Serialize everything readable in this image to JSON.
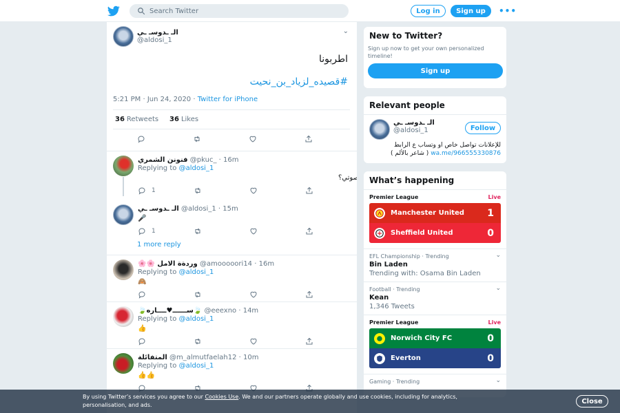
{
  "header": {
    "search_placeholder": "Search Twitter",
    "login_label": "Log in",
    "signup_label": "Sign up",
    "more_label": "•••"
  },
  "tweet": {
    "author_name": "الـ ـدوسـ ـي",
    "author_handle": "@aldosi_1",
    "text": "اطربونا",
    "hashtag": "#قصيده_لزياد_بن_نحيت",
    "time": "5:21 PM · Jun 24, 2020",
    "source_sep": " · ",
    "source": "Twitter for iPhone",
    "retweets_count": "36",
    "retweets_label": "Retweets",
    "likes_count": "36",
    "likes_label": "Likes"
  },
  "replies": [
    {
      "name": "فنونن الشمري",
      "handle": "@pkuc_",
      "time": "· 16m",
      "replying_prefix": "Replying to",
      "replying_to": "@aldosi_1",
      "text": "بصوتي؟",
      "reply_count": "1"
    },
    {
      "name": "الـ ـدوسـ ـي",
      "handle": "@aldosi_1",
      "time": "· 15m",
      "text": "🎤",
      "reply_count": "1",
      "more_label": "1 more reply"
    },
    {
      "name": "🌸🌸 وردةة الامل",
      "handle": "@amooooori14",
      "time": "· 16m",
      "replying_prefix": "Replying to",
      "replying_to": "@aldosi_1",
      "text": "🙈"
    },
    {
      "name": "🍃ســــــ♥ــــاره🍃",
      "handle": "@eeexno",
      "time": "· 14m",
      "replying_prefix": "Replying to",
      "replying_to": "@aldosi_1",
      "text": "👍"
    },
    {
      "name": "المتفائلة",
      "handle": "@m_almutfaelah12",
      "time": "· 10m",
      "replying_prefix": "Replying to",
      "replying_to": "@aldosi_1",
      "text": "👍👍"
    }
  ],
  "sidebar": {
    "new_title": "New to Twitter?",
    "new_text": "Sign up now to get your own personalized timeline!",
    "new_signup": "Sign up",
    "relevant_title": "Relevant people",
    "person_name": "الـ ـدوسـ ـي",
    "person_handle": "@aldosi_1",
    "follow_label": "Follow",
    "bio_text": "للإعلانات تواصل خاص او وتساب ع الرابط",
    "bio_link": "wa.me/966555330876",
    "bio_tail": "( شاعر بالألم )",
    "happening_title": "What’s happening",
    "match1": {
      "league": "Premier League",
      "live": "Live",
      "home": "Manchester United",
      "home_score": "1",
      "away": "Sheffield United",
      "away_score": "0"
    },
    "trend1": {
      "context": "EFL Championship · Trending",
      "name": "Bin Laden",
      "sub": "Trending with: Osama Bin Laden"
    },
    "trend2": {
      "context": "Football · Trending",
      "name": "Kean",
      "sub": "1,346 Tweets"
    },
    "match2": {
      "league": "Premier League",
      "live": "Live",
      "home": "Norwich City FC",
      "home_score": "0",
      "away": "Everton",
      "away_score": "0"
    },
    "trend3": {
      "context": "Gaming · Trending"
    }
  },
  "cookie": {
    "text_before": "By using Twitter’s services you agree to our ",
    "link": "Cookies Use",
    "text_after": ". We and our partners operate globally and use cookies, including for analytics, personalisation, and ads.",
    "close_label": "Close"
  },
  "colors": {
    "brand": "#1da1f2",
    "link": "#1b95e0",
    "live": "#e0245e",
    "man_utd": "#da291c",
    "sheffield": "#ee2737",
    "norwich": "#00833e",
    "everton": "#274488"
  },
  "icons": [
    "twitter-bird-icon",
    "search-icon",
    "chevron-down-icon",
    "reply-icon",
    "retweet-icon",
    "like-icon",
    "share-icon",
    "club-crest-icon"
  ]
}
